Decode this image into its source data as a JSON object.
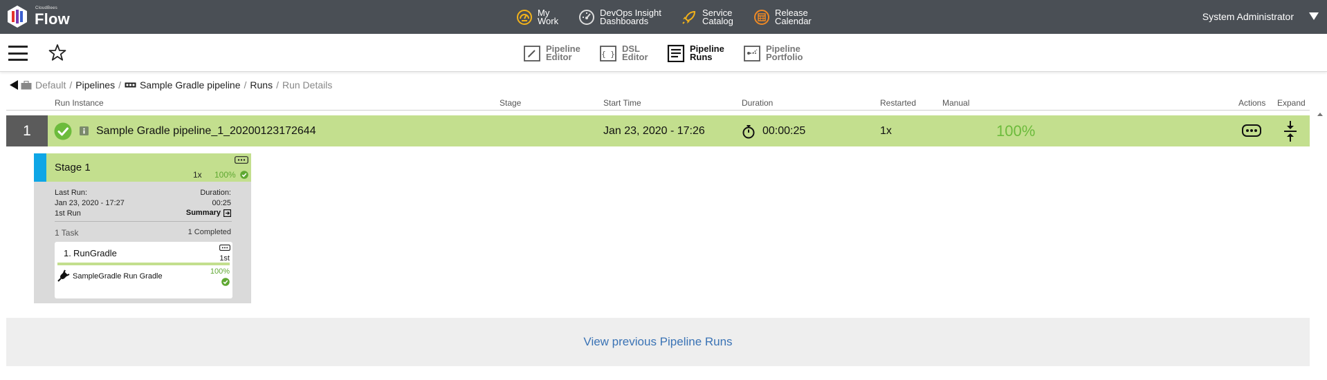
{
  "brand": {
    "small": "CloudBees",
    "name": "Flow"
  },
  "topnav": [
    {
      "label1": "My",
      "label2": "Work",
      "icon": "dashboard-gauge-icon"
    },
    {
      "label1": "DevOps Insight",
      "label2": "Dashboards",
      "icon": "speedometer-icon"
    },
    {
      "label1": "Service",
      "label2": "Catalog",
      "icon": "rocket-icon"
    },
    {
      "label1": "Release",
      "label2": "Calendar",
      "icon": "calendar-icon"
    }
  ],
  "user": "System Administrator",
  "tabs": [
    {
      "label1": "Pipeline",
      "label2": "Editor",
      "icon": "pencil-icon",
      "active": false
    },
    {
      "label1": "DSL",
      "label2": "Editor",
      "icon": "braces-icon",
      "active": false
    },
    {
      "label1": "Pipeline",
      "label2": "Runs",
      "icon": "runs-list-icon",
      "active": true
    },
    {
      "label1": "Pipeline",
      "label2": "Portfolio",
      "icon": "portfolio-icon",
      "active": false
    }
  ],
  "breadcrumb": {
    "project": "Default",
    "pipelines": "Pipelines",
    "pipeline": "Sample Gradle pipeline",
    "runs": "Runs",
    "current": "Run Details",
    "separator": "/"
  },
  "columns": {
    "run_instance": "Run Instance",
    "stage": "Stage",
    "start_time": "Start Time",
    "duration": "Duration",
    "restarted": "Restarted",
    "manual": "Manual",
    "actions": "Actions",
    "expand": "Expand"
  },
  "run": {
    "number": "1",
    "name": "Sample Gradle pipeline_1_20200123172644",
    "start_time": "Jan 23, 2020 - 17:26",
    "duration": "00:00:25",
    "restarted": "1x",
    "progress": "100%"
  },
  "stage": {
    "name": "Stage 1",
    "runs": "1x",
    "progress": "100%",
    "last_run_label": "Last Run:",
    "last_run_value": "Jan 23, 2020 - 17:27",
    "duration_label": "Duration:",
    "duration_value": "00:25",
    "run_ordinal": "1st Run",
    "summary": "Summary",
    "task_count": "1 Task",
    "completed": "1 Completed"
  },
  "task": {
    "index": "1.",
    "name": "RunGradle",
    "ordinal": "1st",
    "progress": "100%",
    "plugin_label": "SampleGradle Run Gradle"
  },
  "view_previous": "View previous Pipeline Runs",
  "colors": {
    "topbar": "#4a4f55",
    "success_green": "#c3df8e",
    "check_green": "#6cbb3c",
    "stage_accent": "#0ea6e6",
    "link_blue": "#3a73b5",
    "nav_icon_gold": "#f2b21a"
  }
}
